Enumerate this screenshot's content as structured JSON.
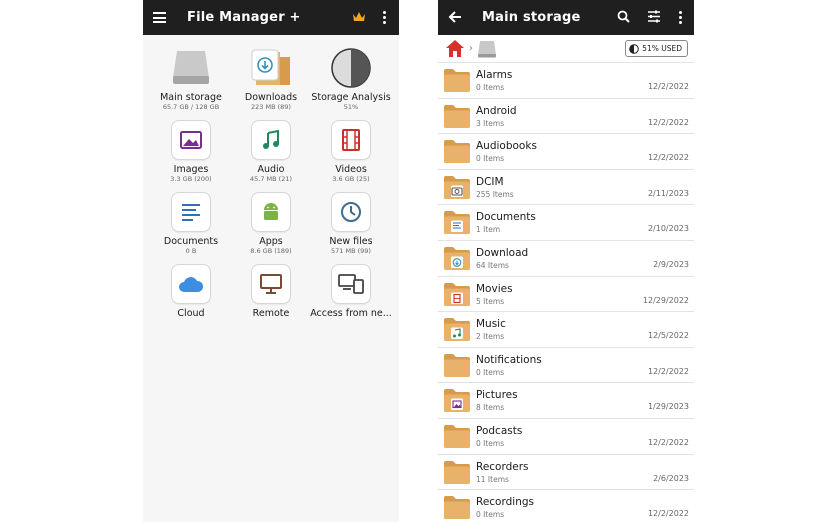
{
  "left_screen": {
    "title": "File Manager +",
    "tiles": [
      {
        "label": "Main storage",
        "sub": "65.7 GB / 128 GB",
        "icon": "hard-drive-icon"
      },
      {
        "label": "Downloads",
        "sub": "223 MB (89)",
        "icon": "download-folder-icon"
      },
      {
        "label": "Storage Analysis",
        "sub": "51%",
        "icon": "pie-icon"
      },
      {
        "label": "Images",
        "sub": "3.3 GB (200)",
        "icon": "image-icon"
      },
      {
        "label": "Audio",
        "sub": "45.7 MB (21)",
        "icon": "music-note-icon"
      },
      {
        "label": "Videos",
        "sub": "3.6 GB (25)",
        "icon": "film-icon"
      },
      {
        "label": "Documents",
        "sub": "0 B",
        "icon": "document-icon"
      },
      {
        "label": "Apps",
        "sub": "8.6 GB (189)",
        "icon": "android-icon"
      },
      {
        "label": "New files",
        "sub": "571 MB (99)",
        "icon": "clock-icon"
      },
      {
        "label": "Cloud",
        "sub": "",
        "icon": "cloud-icon"
      },
      {
        "label": "Remote",
        "sub": "",
        "icon": "monitor-icon"
      },
      {
        "label": "Access from ne...",
        "sub": "",
        "icon": "devices-icon"
      }
    ]
  },
  "right_screen": {
    "title": "Main storage",
    "used_label": "51% USED",
    "folders": [
      {
        "name": "Alarms",
        "count": "0 Items",
        "date": "12/2/2022",
        "badge": ""
      },
      {
        "name": "Android",
        "count": "3 Items",
        "date": "12/2/2022",
        "badge": ""
      },
      {
        "name": "Audiobooks",
        "count": "0 Items",
        "date": "12/2/2022",
        "badge": ""
      },
      {
        "name": "DCIM",
        "count": "255 Items",
        "date": "2/11/2023",
        "badge": "camera"
      },
      {
        "name": "Documents",
        "count": "1 Item",
        "date": "2/10/2023",
        "badge": "doc"
      },
      {
        "name": "Download",
        "count": "64 Items",
        "date": "2/9/2023",
        "badge": "download"
      },
      {
        "name": "Movies",
        "count": "5 Items",
        "date": "12/29/2022",
        "badge": "film"
      },
      {
        "name": "Music",
        "count": "2 Items",
        "date": "12/5/2022",
        "badge": "music"
      },
      {
        "name": "Notifications",
        "count": "0 Items",
        "date": "12/2/2022",
        "badge": ""
      },
      {
        "name": "Pictures",
        "count": "8 Items",
        "date": "1/29/2023",
        "badge": "image"
      },
      {
        "name": "Podcasts",
        "count": "0 Items",
        "date": "12/2/2022",
        "badge": ""
      },
      {
        "name": "Recorders",
        "count": "11 Items",
        "date": "2/6/2023",
        "badge": ""
      },
      {
        "name": "Recordings",
        "count": "0 Items",
        "date": "12/2/2022",
        "badge": ""
      }
    ]
  },
  "colors": {
    "appbar": "#1f1f1f",
    "folder": "#e8b26a",
    "folder_dark": "#d89a4c",
    "crown": "#f5a623",
    "home": "#d9302c"
  }
}
